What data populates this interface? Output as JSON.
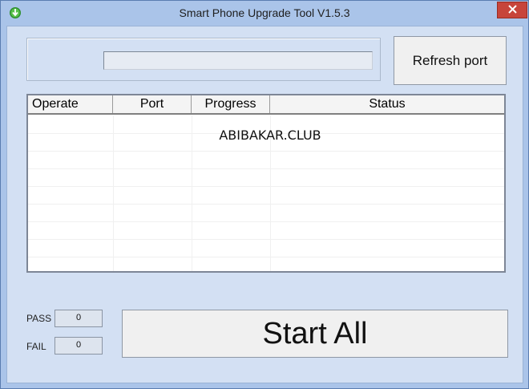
{
  "window": {
    "title": "Smart Phone Upgrade Tool V1.5.3",
    "app_icon": "green-download-arrow-icon",
    "close_icon": "close-icon"
  },
  "top_panel": {
    "progress_value": "",
    "refresh_label": "Refresh port"
  },
  "list": {
    "columns": [
      "Operate",
      "Port",
      "Progress",
      "Status"
    ],
    "rows": [],
    "watermark": "ABIBAKAR.CLUB"
  },
  "counters": {
    "pass_label": "PASS",
    "pass_value": "0",
    "fail_label": "FAIL",
    "fail_value": "0"
  },
  "actions": {
    "start_label": "Start All"
  },
  "colors": {
    "window_bg": "#aac4e9",
    "client_bg": "#d3e0f3",
    "close_button": "#c7453b"
  }
}
